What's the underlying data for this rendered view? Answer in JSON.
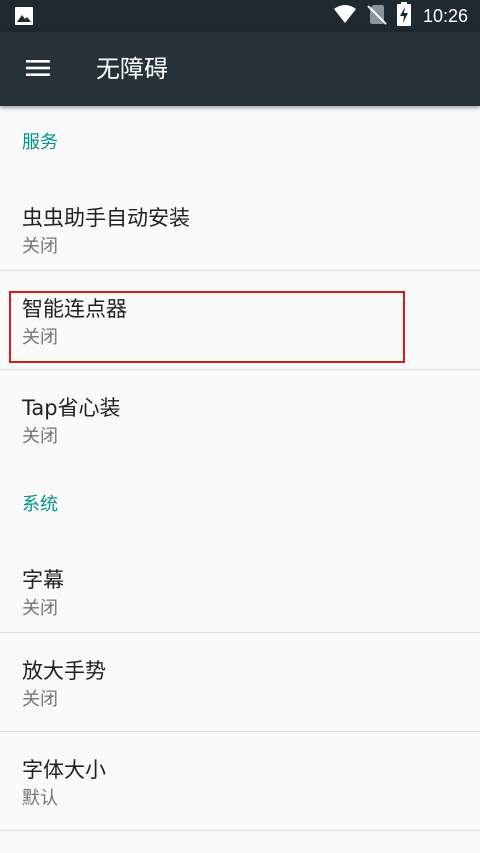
{
  "status_bar": {
    "time": "10:26",
    "icons": [
      "image-notification-icon",
      "wifi-icon",
      "no-sim-icon",
      "battery-charging-icon"
    ]
  },
  "app_bar": {
    "title": "无障碍",
    "menu_icon": "hamburger-menu-icon"
  },
  "sections": [
    {
      "header": "服务",
      "items": [
        {
          "title": "虫虫助手自动安装",
          "summary": "关闭"
        },
        {
          "title": "智能连点器",
          "summary": "关闭"
        },
        {
          "title": "Tap省心装",
          "summary": "关闭"
        }
      ]
    },
    {
      "header": "系统",
      "items": [
        {
          "title": "字幕",
          "summary": "关闭"
        },
        {
          "title": "放大手势",
          "summary": "关闭"
        },
        {
          "title": "字体大小",
          "summary": "默认"
        }
      ]
    }
  ],
  "colors": {
    "status_bar": "#1f2a30",
    "app_bar": "#263238",
    "accent": "#009688",
    "highlight": "#e01818",
    "background": "#fafafa"
  }
}
